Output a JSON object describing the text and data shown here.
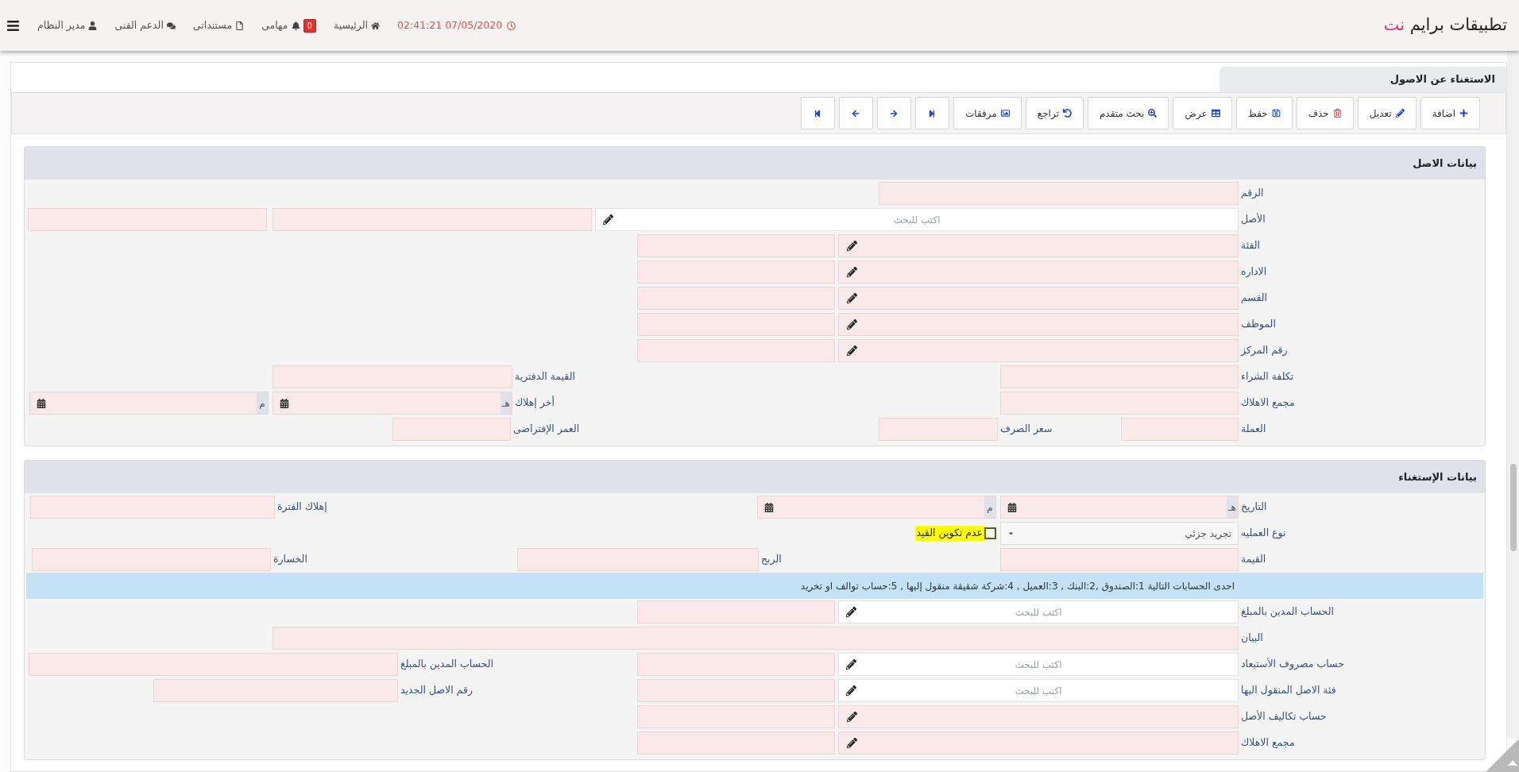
{
  "header": {
    "logo": {
      "main": "تطبيقات برايم",
      "accent": "نت"
    },
    "datetime": "02:41:21 07/05/2020",
    "nav": [
      {
        "kind": "home",
        "label": "الرئيسية"
      },
      {
        "kind": "tasks",
        "label": "مهامى",
        "badge": "0"
      },
      {
        "kind": "documents",
        "label": "مستنداتى"
      },
      {
        "kind": "support",
        "label": "الدعم الفنى"
      },
      {
        "kind": "user",
        "label": "مدير النظام"
      }
    ]
  },
  "page_tab": {
    "title": "الاستغناء عن الاصول"
  },
  "toolbar": {
    "buttons": [
      "اضافة",
      "تعديل",
      "حذف",
      "حفظ",
      "عرض",
      "بحث متقدم",
      "تراجع",
      "مرفقات"
    ]
  },
  "asset_section": {
    "title": "بيانات الاصل",
    "rows": [
      {
        "kind": "single",
        "label": "الرقم"
      },
      {
        "kind": "search_triple",
        "label": "الأصل",
        "placeholder": "اكتب للبحث"
      },
      {
        "kind": "lookup",
        "label": "الفئة"
      },
      {
        "kind": "lookup",
        "label": "الاداره"
      },
      {
        "kind": "lookup",
        "label": "القسم"
      },
      {
        "kind": "lookup",
        "label": "الموظف"
      },
      {
        "kind": "lookup",
        "label": "رقم المركز"
      },
      {
        "kind": "pair",
        "label": "تكلفة الشراء",
        "label_2": "القيمة الدفترية"
      },
      {
        "kind": "pair_dates",
        "label": "مجمع الاهلاك",
        "label_2": "أخر إهلاك",
        "hijri_suffix": "هـ",
        "gregorian_suffix": "م"
      },
      {
        "kind": "triple_small",
        "label": "العملة",
        "label_2": "سعر الصرف",
        "label_3": "العمر الإفتراضى"
      }
    ]
  },
  "withdrawal_section": {
    "title": "بيانات الإستغناء",
    "rows": [
      {
        "kind": "dates",
        "label": "التاريخ",
        "hijri_suffix": "هـ",
        "gregorian_suffix": "م",
        "label_2": "إهلاك الفترة"
      },
      {
        "kind": "select",
        "label": "نوع العمليه",
        "value": "تجريد جزئي",
        "checkbox": {
          "label": "عدم تكوين القيد",
          "checked": false
        }
      },
      {
        "kind": "triple",
        "label": "القيمة",
        "label_2": "الربح",
        "label_3": "الخسارة"
      },
      {
        "kind": "info",
        "text": "احدى الحسابات التالية 1:الصندوق ,2:البنك , 3:العميل , 4:شركة شقيقة منقول إليها , 5:حساب توالف او تخريد"
      },
      {
        "kind": "search_lookup",
        "label": "الحساب المدين بالمبلغ",
        "placeholder": "اكتب للبحث"
      },
      {
        "kind": "wide",
        "label": "البيان"
      },
      {
        "kind": "search_lookup_extra",
        "label": "حساب مصروف الأستبعاد",
        "placeholder": "اكتب للبحث",
        "label_2": "الحساب المدين بالمبلغ"
      },
      {
        "kind": "search_lookup_extra_short",
        "label": "فئة الاصل المنقول اليها",
        "placeholder": "اكتب للبحث",
        "label_2": "رقم الاصل الجديد"
      },
      {
        "kind": "lookup",
        "label": "حساب تكاليف الأصل"
      },
      {
        "kind": "lookup",
        "label": "مجمع الاهلاك"
      }
    ]
  }
}
